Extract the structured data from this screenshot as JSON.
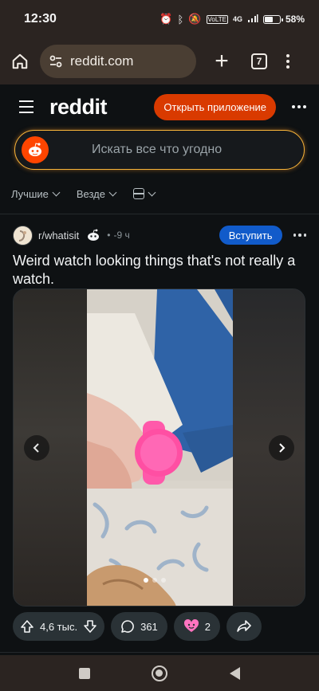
{
  "status_bar": {
    "time": "12:30",
    "network": "4G",
    "volte": "VoLTE",
    "battery": "58%"
  },
  "browser": {
    "url": "reddit.com",
    "tab_count": "7"
  },
  "header": {
    "logo": "reddit",
    "open_app_label": "Открыть приложение"
  },
  "search": {
    "placeholder": "Искать все что угодно"
  },
  "sort": {
    "sort_label": "Лучшие",
    "scope_label": "Везде"
  },
  "post": {
    "subreddit": "r/whatisit",
    "dot": "•",
    "time": "-9 ч",
    "join_label": "Вступить",
    "title": "Weird watch looking things that's not really a watch.",
    "gallery_total": 3,
    "gallery_index": 1,
    "votes": "4,6 тыс.",
    "comments": "361",
    "awards": "2"
  },
  "colors": {
    "accent": "#d93a00",
    "join": "#115bca",
    "search_border": "#f7b43a",
    "watch": "#ff4fa3"
  }
}
